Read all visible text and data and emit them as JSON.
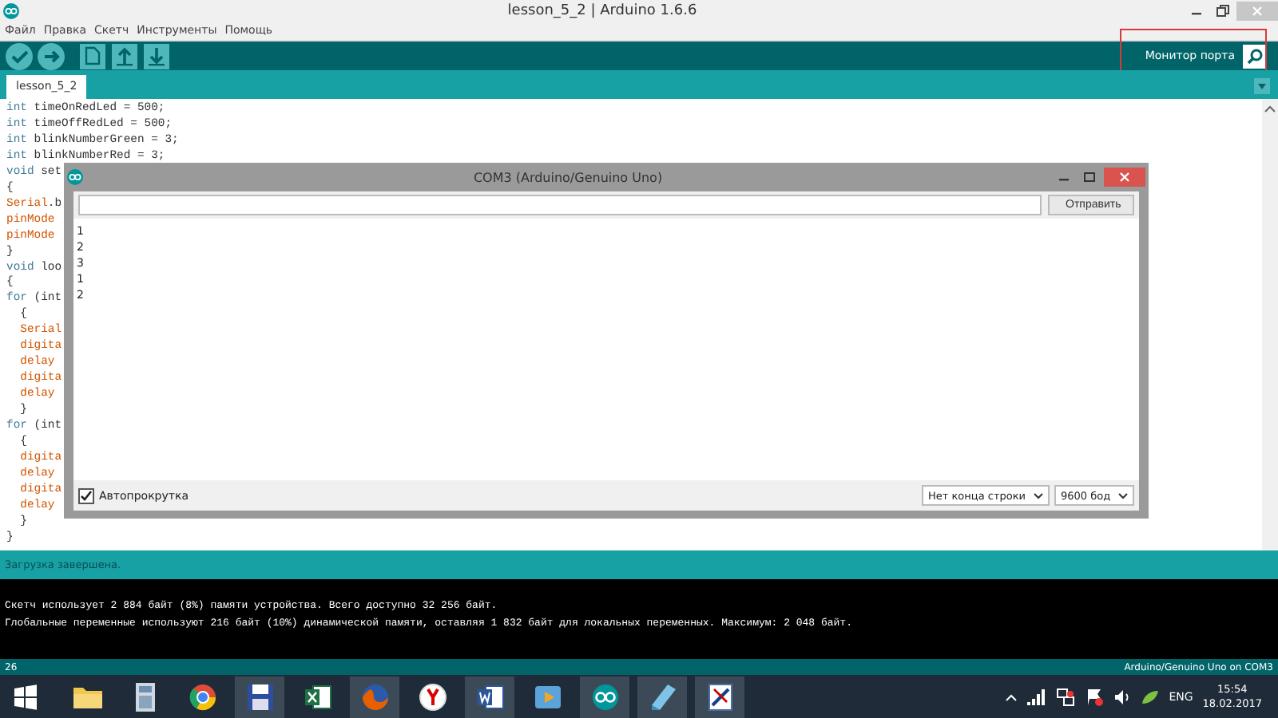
{
  "window": {
    "title": "lesson_5_2 | Arduino 1.6.6"
  },
  "menu": [
    "Файл",
    "Правка",
    "Скетч",
    "Инструменты",
    "Помощь"
  ],
  "toolbar": {
    "buttons": [
      {
        "kind": "verify"
      },
      {
        "kind": "upload"
      },
      {
        "kind": "new"
      },
      {
        "kind": "open"
      },
      {
        "kind": "save"
      }
    ],
    "monitor_label": "Монитор порта"
  },
  "tabs": [
    {
      "label": "lesson_5_2",
      "selected": true
    }
  ],
  "code": [
    [
      {
        "text": "int",
        "kind": "type"
      },
      {
        "text": " timeOnRedLed = 500;",
        "kind": "plain"
      }
    ],
    [
      {
        "text": "int",
        "kind": "type"
      },
      {
        "text": " timeOffRedLed = 500;",
        "kind": "plain"
      }
    ],
    [
      {
        "text": "int",
        "kind": "type"
      },
      {
        "text": " blinkNumberGreen = 3;",
        "kind": "plain"
      }
    ],
    [
      {
        "text": "int",
        "kind": "type"
      },
      {
        "text": " blinkNumberRed = 3;",
        "kind": "plain"
      }
    ],
    [
      {
        "text": "void",
        "kind": "type"
      },
      {
        "text": " set",
        "kind": "plain"
      }
    ],
    [
      {
        "text": "{",
        "kind": "plain"
      }
    ],
    [
      {
        "text": "Serial",
        "kind": "func"
      },
      {
        "text": ".b",
        "kind": "plain"
      }
    ],
    [
      {
        "text": "pinMode",
        "kind": "func"
      }
    ],
    [
      {
        "text": "pinMode",
        "kind": "func"
      }
    ],
    [
      {
        "text": "}",
        "kind": "plain"
      }
    ],
    [
      {
        "text": "void",
        "kind": "type"
      },
      {
        "text": " loo",
        "kind": "plain"
      }
    ],
    [
      {
        "text": "{",
        "kind": "plain"
      }
    ],
    [
      {
        "text": "for",
        "kind": "type"
      },
      {
        "text": " (int",
        "kind": "plain"
      }
    ],
    [
      {
        "text": "  {",
        "kind": "plain"
      }
    ],
    [
      {
        "text": "  Serial",
        "kind": "func"
      }
    ],
    [
      {
        "text": "  digita",
        "kind": "func"
      }
    ],
    [
      {
        "text": "  delay",
        "kind": "func"
      }
    ],
    [
      {
        "text": "  digita",
        "kind": "func"
      }
    ],
    [
      {
        "text": "  delay",
        "kind": "func"
      }
    ],
    [
      {
        "text": "  }",
        "kind": "plain"
      }
    ],
    [
      {
        "text": "for",
        "kind": "type"
      },
      {
        "text": " (int",
        "kind": "plain"
      }
    ],
    [
      {
        "text": "  {",
        "kind": "plain"
      }
    ],
    [
      {
        "text": "  digita",
        "kind": "func"
      }
    ],
    [
      {
        "text": "  delay",
        "kind": "func"
      }
    ],
    [
      {
        "text": "  digita",
        "kind": "func"
      }
    ],
    [
      {
        "text": "  delay",
        "kind": "func"
      }
    ],
    [
      {
        "text": "  }",
        "kind": "plain"
      }
    ],
    [
      {
        "text": "}",
        "kind": "plain"
      }
    ]
  ],
  "serial_monitor": {
    "title": "COM3 (Arduino/Genuino Uno)",
    "send_label": "Отправить",
    "output": [
      "1",
      "2",
      "3",
      "1",
      "2"
    ],
    "autoscroll": {
      "label": "Автопрокрутка",
      "checked": true
    },
    "line_ending": "Нет конца строки",
    "baud": "9600 бод"
  },
  "status": "Загрузка завершена.",
  "console": [
    "Скетч использует 2 884 байт (8%) памяти устройства. Всего доступно 32 256 байт.",
    "Глобальные переменные используют 216 байт (10%) динамической памяти, оставляя 1 832 байт для локальных переменных. Максимум: 2 048 байт."
  ],
  "bottom_bar": {
    "line": "26",
    "board": "Arduino/Genuino Uno on COM3"
  },
  "taskbar": {
    "items": [
      {
        "kind": "folder",
        "active": false
      },
      {
        "kind": "calculator",
        "active": false
      },
      {
        "kind": "globe",
        "active": false
      },
      {
        "kind": "floppy",
        "active": true
      },
      {
        "kind": "sheet",
        "active": false
      },
      {
        "kind": "fox",
        "active": true
      },
      {
        "kind": "ybrowser",
        "active": false
      },
      {
        "kind": "doc",
        "active": true
      },
      {
        "kind": "video",
        "active": false
      },
      {
        "kind": "arduino",
        "active": true
      },
      {
        "kind": "note",
        "active": true
      },
      {
        "kind": "paint",
        "active": true
      }
    ],
    "language": "ENG",
    "time": "15:54",
    "date": "18.02.2017"
  }
}
